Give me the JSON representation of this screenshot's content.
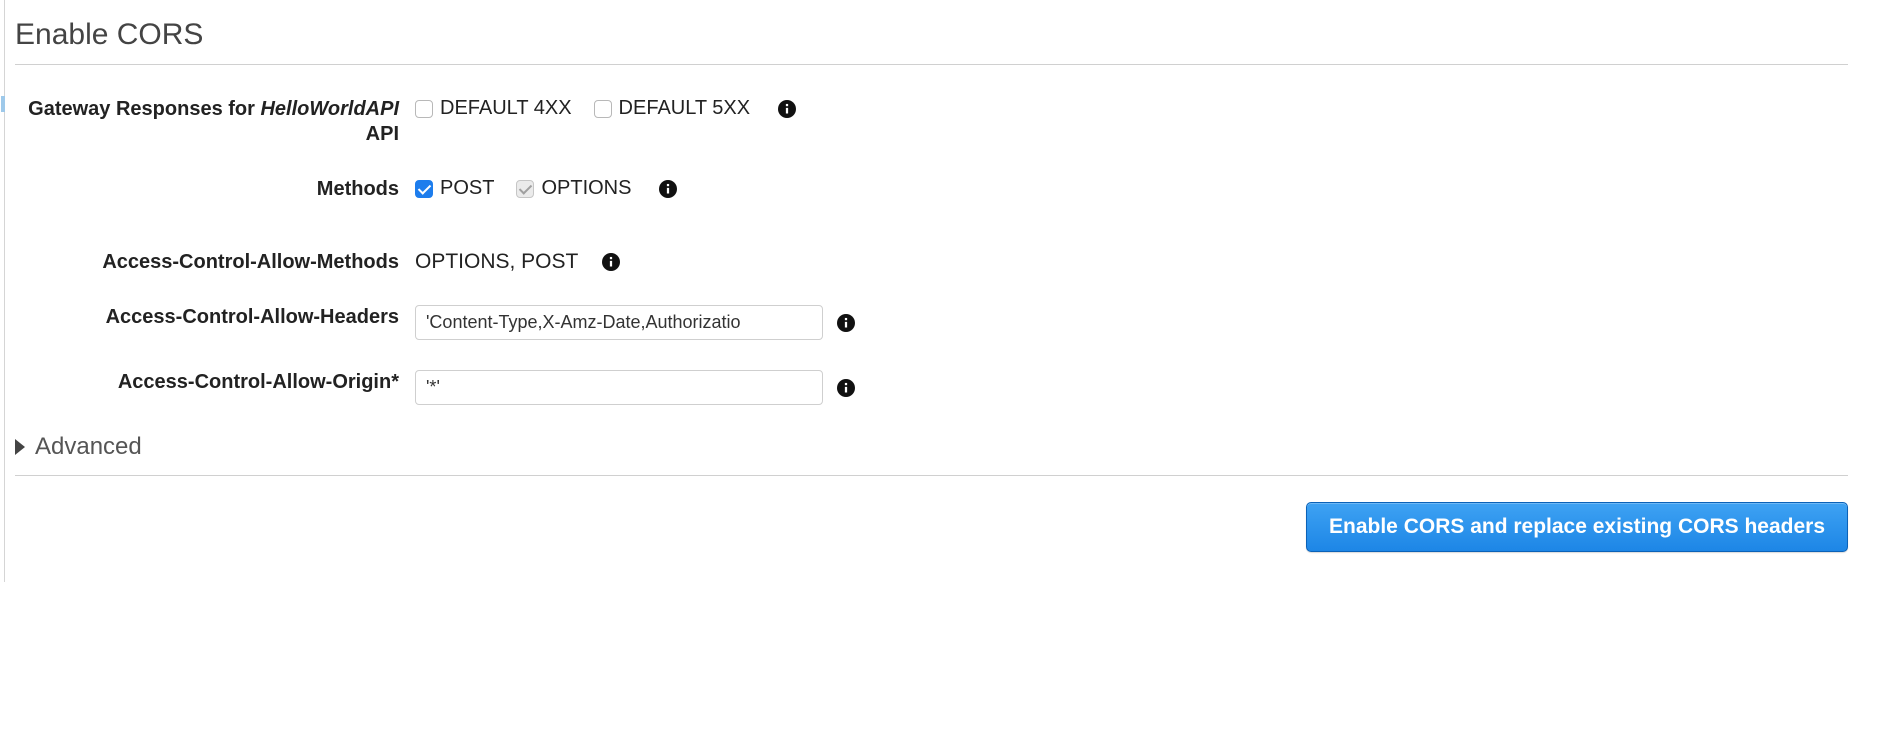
{
  "panel": {
    "title": "Enable CORS"
  },
  "form": {
    "gateway_responses": {
      "label_prefix": "Gateway Responses for ",
      "api_name": "HelloWorldAPI",
      "label_suffix": " API",
      "options": [
        {
          "label": "DEFAULT 4XX",
          "checked": false
        },
        {
          "label": "DEFAULT 5XX",
          "checked": false
        }
      ]
    },
    "methods": {
      "label": "Methods",
      "options": [
        {
          "label": "POST",
          "checked": true,
          "disabled": false
        },
        {
          "label": "OPTIONS",
          "checked": true,
          "disabled": true
        }
      ]
    },
    "allow_methods": {
      "label": "Access-Control-Allow-Methods",
      "value": "OPTIONS, POST"
    },
    "allow_headers": {
      "label": "Access-Control-Allow-Headers",
      "value": "'Content-Type,X-Amz-Date,Authorizatio"
    },
    "allow_origin": {
      "label": "Access-Control-Allow-Origin*",
      "value": "'*'"
    }
  },
  "advanced": {
    "label": "Advanced"
  },
  "actions": {
    "enable_button": "Enable CORS and replace existing CORS headers"
  }
}
